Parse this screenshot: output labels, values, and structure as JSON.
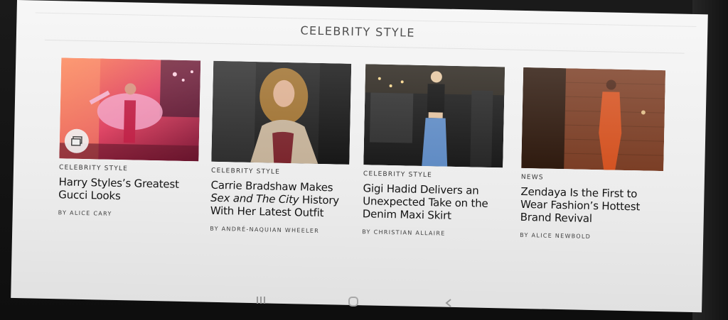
{
  "section": {
    "title": "CELEBRITY STYLE"
  },
  "cards": [
    {
      "kicker": "CELEBRITY STYLE",
      "headline": "Harry Styles’s Greatest Gucci Looks",
      "byline": "BY ALICE CARY",
      "badge_icon": "gallery-icon"
    },
    {
      "kicker": "CELEBRITY STYLE",
      "headline_part1": "Carrie Bradshaw Makes ",
      "headline_italic": "Sex and The City",
      "headline_part2": " History With Her Latest Outfit",
      "byline": "BY ANDRÉ-NAQUIAN WHEELER"
    },
    {
      "kicker": "CELEBRITY STYLE",
      "headline": "Gigi Hadid Delivers an Unexpected Take on the Denim Maxi Skirt",
      "byline": "BY CHRISTIAN ALLAIRE"
    },
    {
      "kicker": "NEWS",
      "headline": "Zendaya Is the First to Wear Fashion’s Hottest Brand Revival",
      "byline": "BY ALICE NEWBOLD"
    }
  ],
  "navbar": {
    "recents_icon": "recent-apps-icon",
    "home_icon": "home-icon",
    "back_icon": "back-icon"
  },
  "colors": {
    "page_bg": "#f4f4f4",
    "text": "#141414",
    "device": "#141414"
  }
}
